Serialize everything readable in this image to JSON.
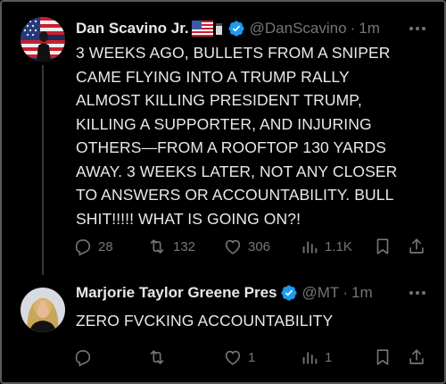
{
  "tweets": [
    {
      "author_name": "Dan Scavino Jr.",
      "handle": "@DanScavino",
      "separator": "·",
      "time": "1m",
      "lines": [
        "3 WEEKS AGO, BULLETS FROM A SNIPER",
        "CAME FLYING INTO A TRUMP RALLY",
        "ALMOST KILLING PRESIDENT TRUMP,",
        "KILLING A SUPPORTER, AND INJURING",
        "OTHERS—FROM A ROOFTOP 130 YARDS",
        "AWAY. 3 WEEKS LATER, NOT ANY CLOSER",
        "TO ANSWERS OR ACCOUNTABILITY. BULL",
        "SHIT!!!!! WHAT IS GOING ON?!"
      ],
      "replies": "28",
      "reposts": "132",
      "likes": "306",
      "views": "1.1K"
    },
    {
      "author_name": "Marjorie Taylor Greene Pres",
      "handle": "@MT",
      "separator": "·",
      "time": "1m",
      "lines": [
        "ZERO FVCKING ACCOUNTABILITY"
      ],
      "replies": "",
      "reposts": "",
      "likes": "1",
      "views": "1"
    }
  ],
  "icons": {
    "reply": "reply-icon",
    "repost": "repost-icon",
    "like": "heart-icon",
    "views": "views-icon",
    "bookmark": "bookmark-icon",
    "share": "share-icon",
    "more": "more-icon",
    "verified": "verified-badge-icon"
  },
  "colors": {
    "background": "#000000",
    "text": "#e7e9ea",
    "muted": "#71767b",
    "verified": "#1d9bf0",
    "thread_line": "#333639"
  }
}
